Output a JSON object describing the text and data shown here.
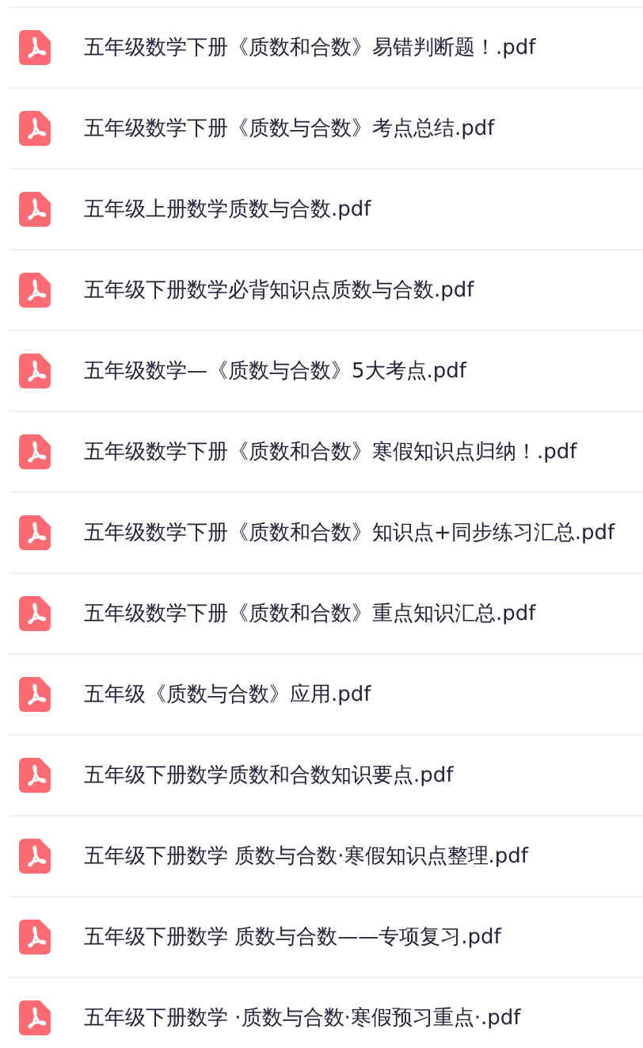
{
  "files": [
    {
      "name": "五年级数学下册《质数和合数》易错判断题！.pdf"
    },
    {
      "name": "五年级数学下册《质数与合数》考点总结.pdf"
    },
    {
      "name": "五年级上册数学质数与合数.pdf"
    },
    {
      "name": "五年级下册数学必背知识点质数与合数.pdf"
    },
    {
      "name": "五年级数学—《质数与合数》5大考点.pdf"
    },
    {
      "name": "五年级数学下册《质数和合数》寒假知识点归纳！.pdf"
    },
    {
      "name": "五年级数学下册《质数和合数》知识点+同步练习汇总.pdf"
    },
    {
      "name": "五年级数学下册《质数和合数》重点知识汇总.pdf"
    },
    {
      "name": "五年级《质数与合数》应用.pdf"
    },
    {
      "name": "五年级下册数学质数和合数知识要点.pdf"
    },
    {
      "name": "五年级下册数学 质数与合数·寒假知识点整理.pdf"
    },
    {
      "name": "五年级下册数学 质数与合数——专项复习.pdf"
    },
    {
      "name": "五年级下册数学 ·质数与合数·寒假预习重点·.pdf"
    }
  ]
}
